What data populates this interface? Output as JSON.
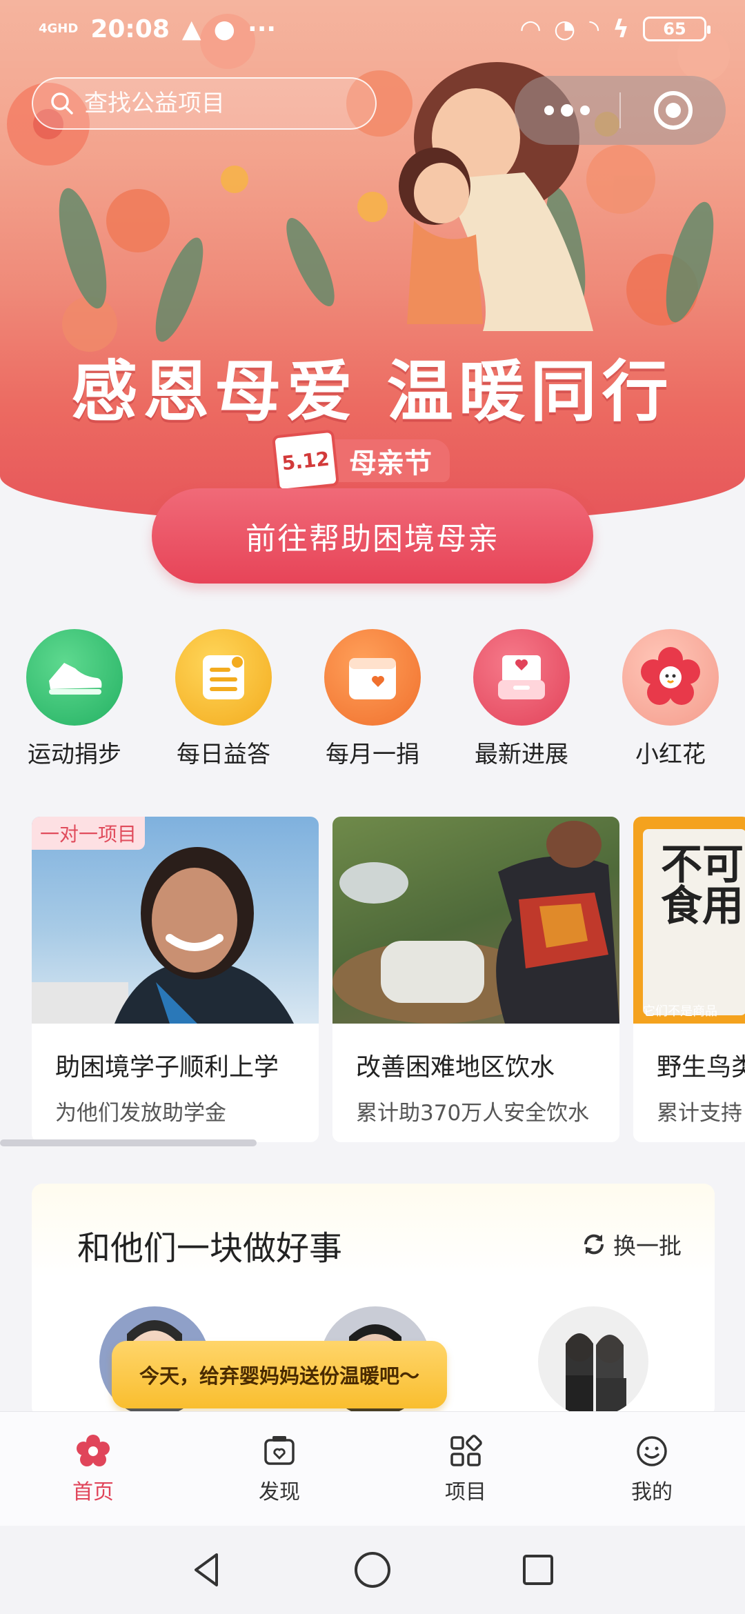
{
  "status_bar": {
    "network": "4GHD",
    "time": "20:08",
    "battery": "65"
  },
  "search": {
    "placeholder": "查找公益项目"
  },
  "hero": {
    "title": "感恩母爱 温暖同行",
    "date_badge": "5.12",
    "festival_tag": "母亲节",
    "cta_label": "前往帮助困境母亲"
  },
  "actions": [
    {
      "label": "运动捐步",
      "icon": "sneaker-icon",
      "color": "#2fbf72"
    },
    {
      "label": "每日益答",
      "icon": "notepad-icon",
      "color": "#f6b62a"
    },
    {
      "label": "每月一捐",
      "icon": "calendar-heart-icon",
      "color": "#f47c3c"
    },
    {
      "label": "最新进展",
      "icon": "inbox-heart-icon",
      "color": "#ea4e62"
    },
    {
      "label": "小红花",
      "icon": "red-flower-icon",
      "color": "#f6a597"
    }
  ],
  "projects": [
    {
      "tag": "一对一项目",
      "title": "助困境学子顺利上学",
      "subtitle": "为他们发放助学金"
    },
    {
      "title": "改善困难地区饮水",
      "subtitle": "累计助370万人安全饮水"
    },
    {
      "title": "野生鸟类",
      "subtitle": "累计支持",
      "image_text": "不可食用",
      "image_caption": "它们不是商品"
    }
  ],
  "do_good": {
    "title": "和他们一块做好事",
    "refresh_label": "换一批",
    "tooltip": "今天，给弃婴妈妈送份温暖吧～"
  },
  "tabbar": [
    {
      "label": "首页",
      "icon": "flower-icon",
      "active": true
    },
    {
      "label": "发现",
      "icon": "discover-icon",
      "active": false
    },
    {
      "label": "项目",
      "icon": "grid-icon",
      "active": false
    },
    {
      "label": "我的",
      "icon": "smile-icon",
      "active": false
    }
  ],
  "colors": {
    "accent": "#e0455a",
    "cta": "#e74458"
  }
}
